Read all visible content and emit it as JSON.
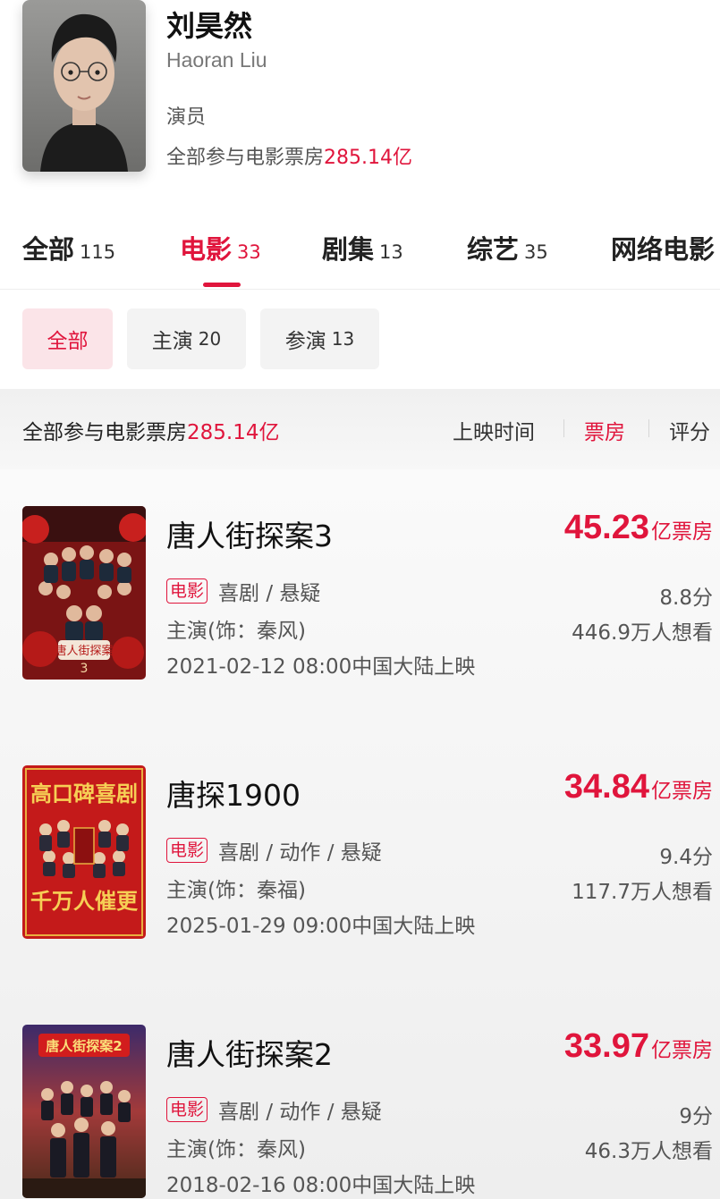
{
  "actor": {
    "name_cn": "刘昊然",
    "name_en": "Haoran Liu",
    "role": "演员",
    "total_prefix": "全部参与电影票房",
    "total_amount": "285.14亿"
  },
  "tabs": [
    {
      "label": "全部",
      "count": "115",
      "active": false
    },
    {
      "label": "电影",
      "count": "33",
      "active": true
    },
    {
      "label": "剧集",
      "count": "13",
      "active": false
    },
    {
      "label": "综艺",
      "count": "35",
      "active": false
    },
    {
      "label": "网络电影",
      "count": "",
      "active": false
    }
  ],
  "filters": [
    {
      "label": "全部",
      "count": "",
      "active": true
    },
    {
      "label": "主演",
      "count": "20",
      "active": false
    },
    {
      "label": "参演",
      "count": "13",
      "active": false
    }
  ],
  "sortbar": {
    "prefix": "全部参与电影票房",
    "amount": "285.14亿",
    "options": [
      "上映时间",
      "票房",
      "评分"
    ],
    "active": "票房"
  },
  "colors": {
    "accent": "#e0153c",
    "accent_bg": "#fbe4e8"
  },
  "movies": [
    {
      "title": "唐人街探案3",
      "box_value": "45.23",
      "box_unit": "亿票房",
      "tag": "电影",
      "genres": "喜剧 / 悬疑",
      "role": "主演(饰：秦风)",
      "release": "2021-02-12 08:00中国大陆上映",
      "score": "8.8分",
      "want": "446.9万人想看",
      "poster_icon": "movie-poster-icon"
    },
    {
      "title": "唐探1900",
      "box_value": "34.84",
      "box_unit": "亿票房",
      "tag": "电影",
      "genres": "喜剧 / 动作 / 悬疑",
      "role": "主演(饰：秦福)",
      "release": "2025-01-29 09:00中国大陆上映",
      "score": "9.4分",
      "want": "117.7万人想看",
      "poster_text_top": "高口碑喜剧",
      "poster_text_bottom": "千万人催更",
      "poster_icon": "movie-poster-icon"
    },
    {
      "title": "唐人街探案2",
      "box_value": "33.97",
      "box_unit": "亿票房",
      "tag": "电影",
      "genres": "喜剧 / 动作 / 悬疑",
      "role": "主演(饰：秦风)",
      "release": "2018-02-16 08:00中国大陆上映",
      "score": "9分",
      "want": "46.3万人想看",
      "poster_icon": "movie-poster-icon"
    }
  ]
}
